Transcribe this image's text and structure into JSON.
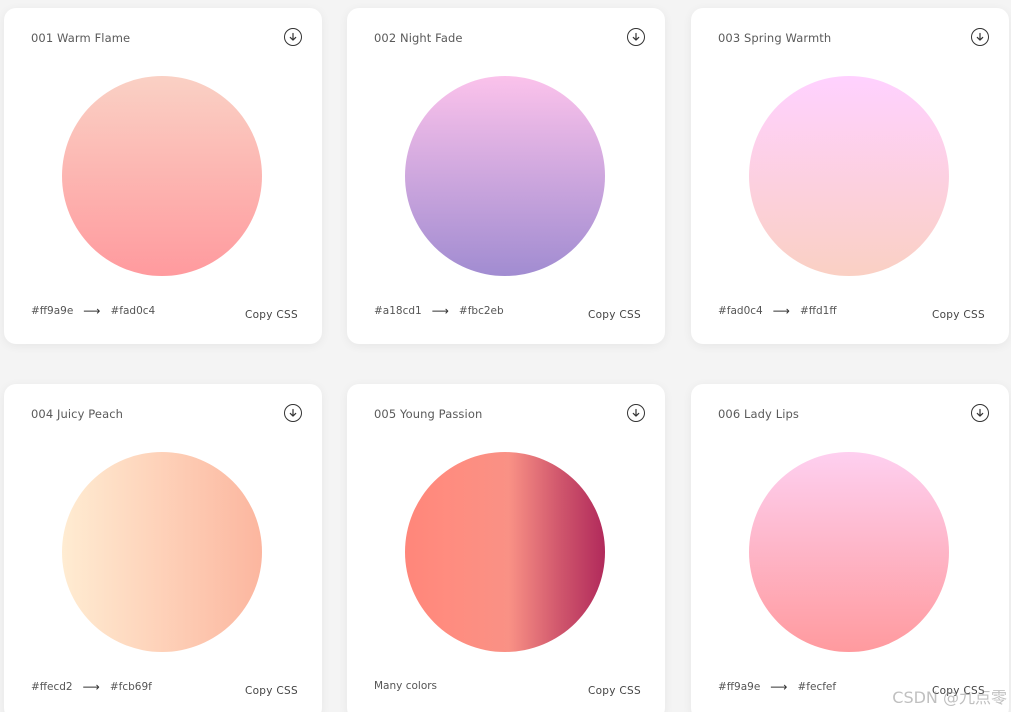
{
  "cards": [
    {
      "title": "001 Warm Flame",
      "from": "#ff9a9e",
      "to": "#fad0c4",
      "arrow": "⟶",
      "copy_label": "Copy CSS"
    },
    {
      "title": "002 Night Fade",
      "from": "#a18cd1",
      "to": "#fbc2eb",
      "arrow": "⟶",
      "copy_label": "Copy CSS"
    },
    {
      "title": "003 Spring Warmth",
      "from": "#fad0c4",
      "to": "#ffd1ff",
      "arrow": "⟶",
      "copy_label": "Copy CSS"
    },
    {
      "title": "004 Juicy Peach",
      "from": "#ffecd2",
      "to": "#fcb69f",
      "arrow": "⟶",
      "copy_label": "Copy CSS"
    },
    {
      "title": "005 Young Passion",
      "colors_text": "Many colors",
      "copy_label": "Copy CSS"
    },
    {
      "title": "006 Lady Lips",
      "from": "#ff9a9e",
      "to": "#fecfef",
      "arrow": "⟶",
      "copy_label": "Copy CSS"
    }
  ],
  "icons": {
    "download": "download-circle-icon",
    "arrow": "long-right-arrow-icon"
  },
  "watermark": "CSDN @九点零"
}
